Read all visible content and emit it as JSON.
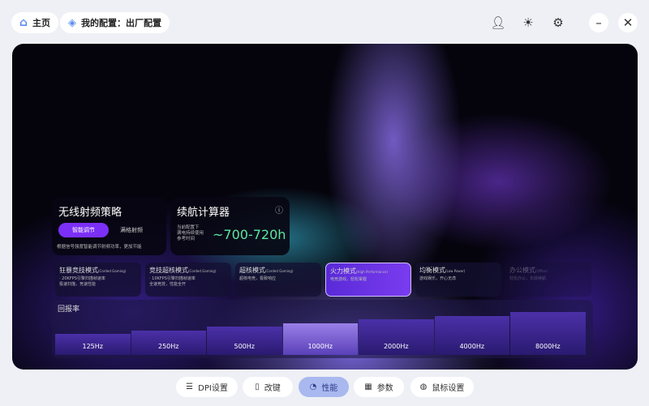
{
  "header": {
    "home": "主页",
    "config": "我的配置：出厂配置"
  },
  "wireless": {
    "title": "无线射频策略",
    "btn_smart": "智能调节",
    "btn_full": "满格射频",
    "desc": "根据信号强度智能调节射频功率，更加节能"
  },
  "battery": {
    "title": "续航计算器",
    "note": "当前配置下\n满电持续使用\n参考时间",
    "value": "~700-720h"
  },
  "modes": [
    {
      "name": "狂暴竞技模式",
      "en": "(Corded Gaming)",
      "desc": "· 20KFPS引擎扫描帧速率\n极速扫描，竞速性能"
    },
    {
      "name": "竞技超核模式",
      "en": "(Corded Gaming)",
      "desc": "· 10KFPS引擎扫描帧速率\n全速竞技，性能全开"
    },
    {
      "name": "超核模式",
      "en": "(Corded Gaming)",
      "desc": "超核电竞，极致响应"
    },
    {
      "name": "火力模式",
      "en": "(High Performance)",
      "desc": "电竞游戏，轻松掌握"
    },
    {
      "name": "均衡模式",
      "en": "(Low Power)",
      "desc": "游戏娱乐，开心无虑"
    },
    {
      "name": "办公模式",
      "en": "(Office)",
      "desc": "轻松办公，长效续航"
    }
  ],
  "selected_mode": "火力模式",
  "polling": {
    "title": "回报率",
    "rates": [
      "125Hz",
      "250Hz",
      "500Hz",
      "1000Hz",
      "2000Hz",
      "4000Hz",
      "8000Hz"
    ],
    "selected": "1000Hz"
  },
  "tabs": [
    {
      "label": "DPI设置",
      "icon": "sliders-icon"
    },
    {
      "label": "改键",
      "icon": "mouse-icon"
    },
    {
      "label": "性能",
      "icon": "gauge-icon",
      "active": true
    },
    {
      "label": "参数",
      "icon": "grid-icon"
    },
    {
      "label": "鼠标设置",
      "icon": "mouse-settings-icon"
    }
  ],
  "colors": {
    "accent": "#7b2ff7",
    "battery_value": "#5ee6a0",
    "tab_active": "#a9b8ee"
  }
}
